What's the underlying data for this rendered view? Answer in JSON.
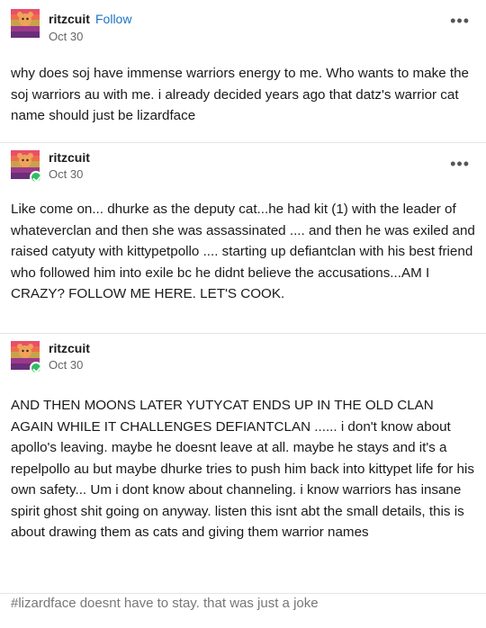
{
  "posts": [
    {
      "username": "ritzcuit",
      "follow_label": "Follow",
      "date": "Oct 30",
      "body": "why does soj have immense warriors energy to me. Who wants to make the soj warriors au with me. i already decided years ago that datz's warrior cat name should just be lizardface"
    },
    {
      "username": "ritzcuit",
      "date": "Oct 30",
      "body": "Like come on... dhurke as the deputy cat...he had kit (1) with the leader of whateverclan and then she was assassinated .... and then he was exiled and raised catyuty with kittypetpollo .... starting up defiantclan with his best friend who followed him into exile bc he didnt believe the accusations...AM I CRAZY? FOLLOW ME HERE. LET'S COOK."
    },
    {
      "username": "ritzcuit",
      "date": "Oct 30",
      "body": "AND THEN MOONS LATER YUTYCAT ENDS UP IN THE OLD CLAN AGAIN WHILE IT CHALLENGES DEFIANTCLAN ...... i don't know about apollo's leaving. maybe he doesnt leave at all. maybe he stays and it's a repelpollo au but maybe dhurke tries to push him back into kittypet life for his own safety... Um i dont know about channeling. i know warriors has insane spirit ghost shit going on anyway. listen this isnt abt the small details, this is about drawing them as cats and giving them warrior names"
    }
  ],
  "tags": "#lizardface doesnt have to stay. that was just a joke",
  "menu_glyph": "•••",
  "colors": {
    "follow": "#1a73c6",
    "badge": "#2dbe60"
  },
  "icons": {
    "avatar": "avatar-icon",
    "menu": "more-options-icon",
    "badge": "follow-check-icon"
  }
}
